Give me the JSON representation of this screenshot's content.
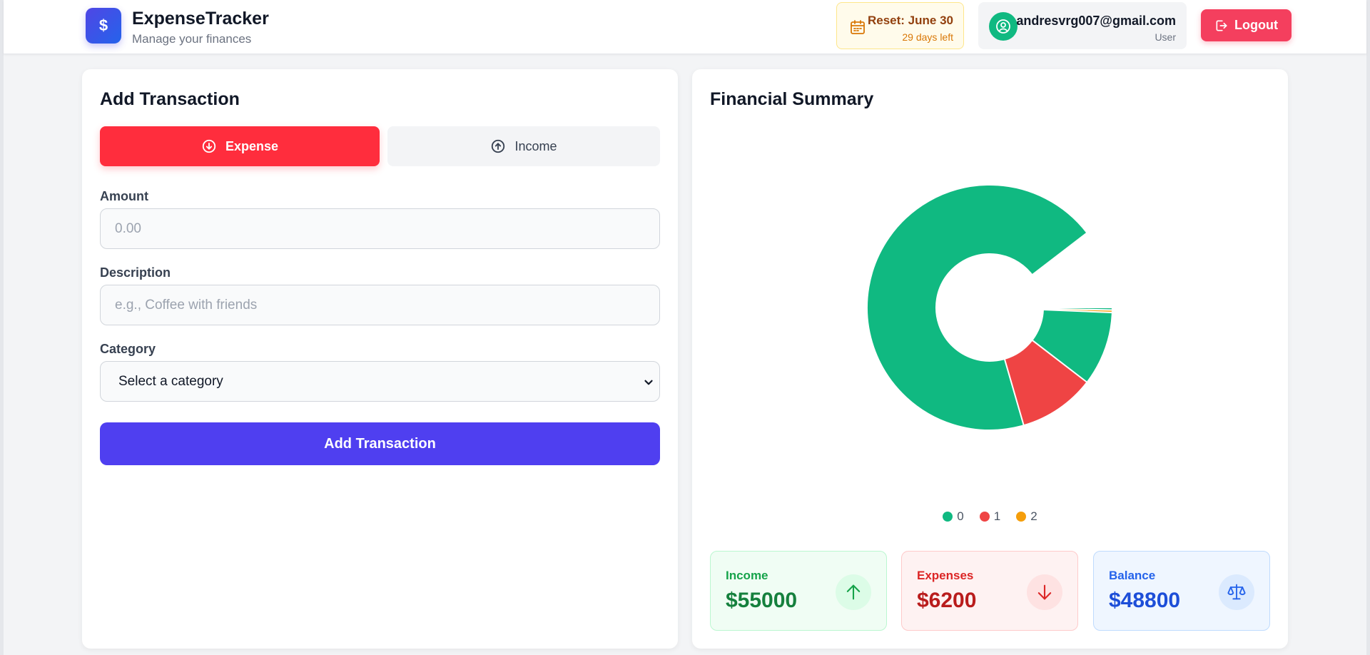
{
  "header": {
    "logo_symbol": "$",
    "app_title": "ExpenseTracker",
    "app_subtitle": "Manage your finances",
    "reset_title": "Reset: June 30",
    "reset_days": "29 days left",
    "user_email": "andresvrg007@gmail.com",
    "user_role": "User",
    "logout_label": "Logout"
  },
  "add_form": {
    "title": "Add Transaction",
    "tab_expense": "Expense",
    "tab_income": "Income",
    "active_tab": "Expense",
    "amount_label": "Amount",
    "amount_placeholder": "0.00",
    "amount_value": "",
    "description_label": "Description",
    "description_placeholder": "e.g., Coffee with friends",
    "description_value": "",
    "category_label": "Category",
    "category_selected": "Select a category",
    "submit_label": "Add Transaction"
  },
  "summary": {
    "title": "Financial Summary",
    "income_label": "Income",
    "income_value": "$55000",
    "expenses_label": "Expenses",
    "expenses_value": "$6200",
    "balance_label": "Balance",
    "balance_value": "$48800"
  },
  "chart_data": {
    "type": "pie",
    "hole": "donut",
    "categories": [
      "0",
      "1",
      "2"
    ],
    "values": [
      55000,
      6200,
      200
    ],
    "colors": [
      "#10b981",
      "#ef4444",
      "#f59e0b"
    ],
    "legend_position": "bottom",
    "title": ""
  },
  "icons": {
    "reset": "calendar-icon",
    "user": "user-circle-icon",
    "logout": "logout-icon",
    "expense_tab": "arrow-down-circle-icon",
    "income_tab": "arrow-up-circle-icon",
    "income_stat": "arrow-up-icon",
    "expense_stat": "arrow-down-icon",
    "balance_stat": "scale-icon"
  }
}
